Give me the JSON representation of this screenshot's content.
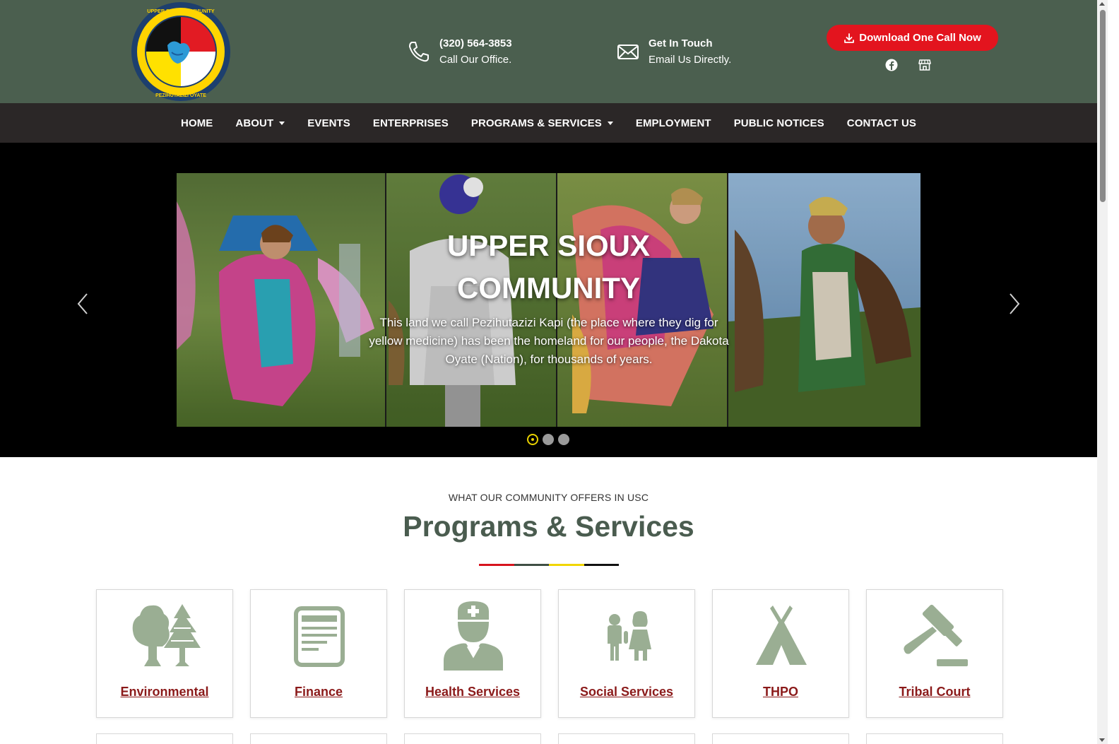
{
  "header": {
    "logo_alt": "Upper Sioux Community — Pezihutazizi Oyate",
    "logo_text_top": "UPPER SIOUX COMMUNITY",
    "logo_text_bottom": "PEZIHUTAZIZI OYATE",
    "phone": {
      "title": "(320) 564-3853",
      "subtitle": "Call Our Office."
    },
    "email": {
      "title": "Get In Touch",
      "subtitle": "Email Us Directly."
    },
    "download_button": "Download One Call Now",
    "social": [
      {
        "icon": "facebook-icon"
      },
      {
        "icon": "store-icon"
      }
    ],
    "colors": {
      "bg": "#4b5f4f",
      "accent": "#e3141e"
    }
  },
  "nav": {
    "items": [
      {
        "label": "HOME",
        "dropdown": false
      },
      {
        "label": "ABOUT",
        "dropdown": true
      },
      {
        "label": "EVENTS",
        "dropdown": false
      },
      {
        "label": "ENTERPRISES",
        "dropdown": false
      },
      {
        "label": "PROGRAMS & SERVICES",
        "dropdown": true
      },
      {
        "label": "EMPLOYMENT",
        "dropdown": false
      },
      {
        "label": "PUBLIC NOTICES",
        "dropdown": false
      },
      {
        "label": "CONTACT US",
        "dropdown": false
      }
    ]
  },
  "hero": {
    "title_line1": "UPPER SIOUX",
    "title_line2": "COMMUNITY",
    "text": "This land we call Pezihutazizi Kapi (the place where they dig for yellow medicine) has been the homeland for our people, the Dakota Oyate (Nation), for thousands of years.",
    "slide_count": 3,
    "active_slide": 1
  },
  "services": {
    "kicker": "WHAT OUR COMMUNITY OFFERS IN USC",
    "title": "Programs & Services",
    "divider_colors": [
      "#d7141e",
      "#3f4f44",
      "#f1d600",
      "#111111"
    ],
    "icon_color": "#9aae93",
    "cards": [
      {
        "label": "Environmental",
        "icon": "trees-icon"
      },
      {
        "label": "Finance",
        "icon": "document-icon"
      },
      {
        "label": "Health Services",
        "icon": "doctor-icon"
      },
      {
        "label": "Social Services",
        "icon": "children-icon"
      },
      {
        "label": "THPO",
        "icon": "tipi-icon"
      },
      {
        "label": "Tribal Court",
        "icon": "gavel-icon"
      }
    ]
  }
}
